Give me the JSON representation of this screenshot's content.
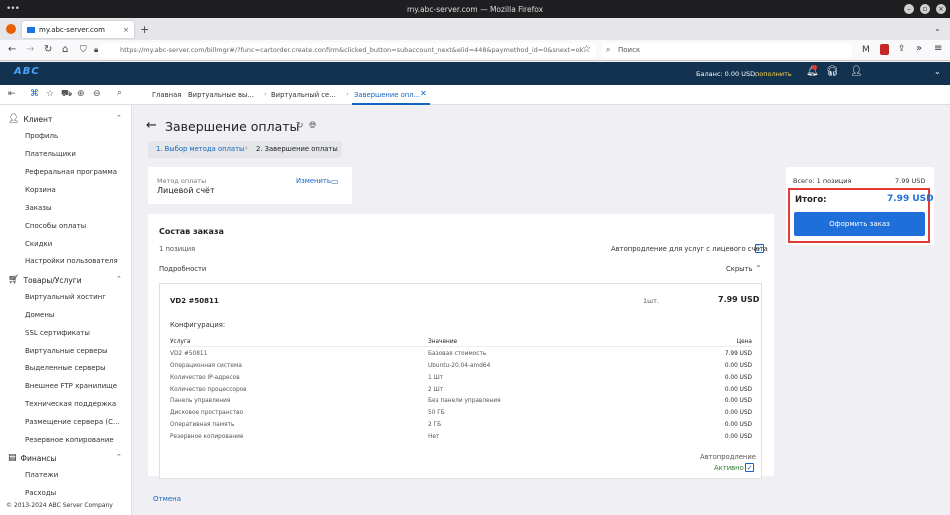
{
  "browser": {
    "window_title": "my.abc-server.com — Mozilla Firefox",
    "tab_title": "my.abc-server.com",
    "new_tab": "+",
    "url": "https://my.abc-server.com/billmgr#/?func=cartorder.create.confirm&clicked_button=subaccount_next&elid=448&paymethod_id=0&snext=ok",
    "search_placeholder": "Поиск"
  },
  "header": {
    "logo": "ABC",
    "balance_label": "Баланс: 0.00 USD,",
    "topup": "пополнить"
  },
  "tabs": [
    {
      "label": "Главная"
    },
    {
      "label": "Виртуальные вы..."
    },
    {
      "label": "Виртуальный се..."
    },
    {
      "label": "Завершение опл..."
    }
  ],
  "sidebar": {
    "client": {
      "label": "Клиент",
      "items": [
        "Профиль",
        "Плательщики",
        "Реферальная программа",
        "Корзина",
        "Заказы",
        "Способы оплаты",
        "Скидки",
        "Настройки пользователя"
      ]
    },
    "products": {
      "label": "Товары/Услуги",
      "items": [
        "Виртуальный хостинг",
        "Домены",
        "SSL сертификаты",
        "Виртуальные серверы",
        "Выделенные серверы",
        "Внешнее FTP хранилище",
        "Техническая поддержка",
        "Размещение сервера (С...",
        "Резервное копирование"
      ]
    },
    "finance": {
      "label": "Финансы",
      "items": [
        "Платежи",
        "Расходы"
      ]
    },
    "copyright": "© 2013-2024 ABC Server Company"
  },
  "page": {
    "title": "Завершение оплаты",
    "steps": [
      "1. Выбор метода оплаты",
      "2. Завершение оплаты"
    ],
    "step_sep": "›",
    "payment_method_label": "Метод оплаты",
    "payment_method_value": "Лицевой счёт",
    "change": "Изменить",
    "order_title": "Состав заказа",
    "positions": "1 позиция",
    "autoprolong_label": "Автопродление для услуг с лицевого счёта",
    "details": "Подробности",
    "hide": "Скрыть",
    "cancel": "Отмена"
  },
  "item": {
    "name": "VD2 #50811",
    "qty": "1шт.",
    "price": "7.99 USD",
    "config_label": "Конфигурация:",
    "columns": [
      "Услуга",
      "Значение",
      "Цена"
    ],
    "rows": [
      [
        "VD2 #50811",
        "Базовая стоимость",
        "7.99 USD"
      ],
      [
        "Операционная система",
        "Ubuntu-20.04-amd64",
        "0.00 USD"
      ],
      [
        "Количество IP-адресов",
        "1 Шт",
        "0.00 USD"
      ],
      [
        "Количество процессоров",
        "2 Шт",
        "0.00 USD"
      ],
      [
        "Панель управления",
        "Без панели управления",
        "0.00 USD"
      ],
      [
        "Дисковое пространство",
        "50 ГБ",
        "0.00 USD"
      ],
      [
        "Оперативная память",
        "2 ГБ",
        "0.00 USD"
      ],
      [
        "Резервное копирование",
        "Нет",
        "0.00 USD"
      ]
    ],
    "autoprolong": "Автопродление",
    "active": "Активно"
  },
  "summary": {
    "total_items": "Всего: 1 позиция",
    "total_items_price": "7.99 USD",
    "total_label": "Итого:",
    "total_price": "7.99 USD",
    "order_button": "Оформить заказ"
  },
  "colors": {
    "accent": "#1565c0",
    "header": "#13324f",
    "highlight": "#e53935",
    "button": "#1e6fd9",
    "active": "#2e7d32"
  }
}
